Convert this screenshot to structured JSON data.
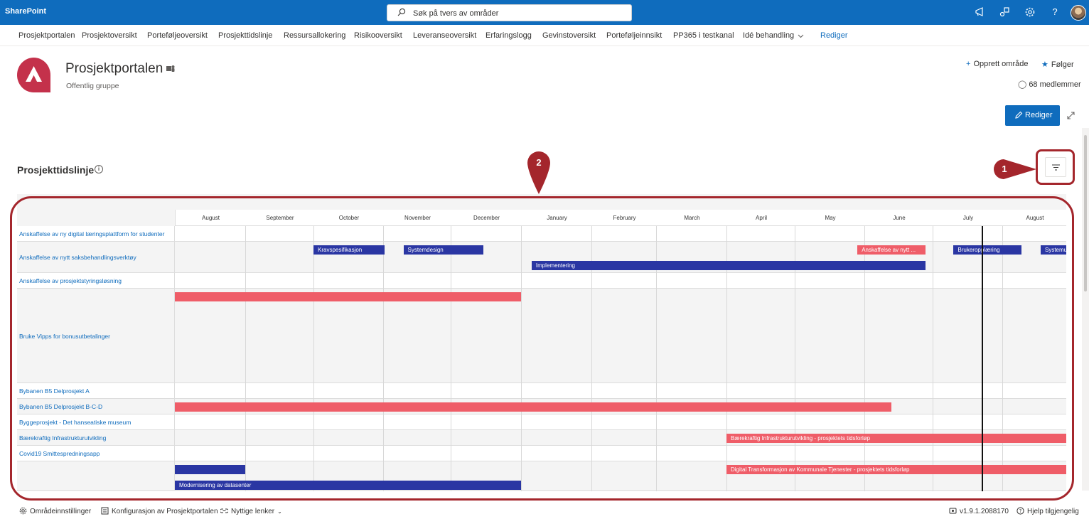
{
  "suitebar": {
    "brand": "SharePoint",
    "search_placeholder": "Søk på tvers av områder",
    "icons": [
      "megaphone-icon",
      "app-icon",
      "gear-icon",
      "help-icon"
    ]
  },
  "nav": {
    "items": [
      "Prosjektportalen",
      "Prosjektoversikt",
      "Porteføljeoversikt",
      "Prosjekttidslinje",
      "Ressursallokering",
      "Risikooversikt",
      "Leveranseoversikt",
      "Erfaringslogg",
      "Gevinstoversikt",
      "Porteføljeinnsikt",
      "PP365 i testkanal",
      "Idé behandling"
    ],
    "edit_label": "Rediger"
  },
  "site": {
    "title": "Prosjektportalen",
    "subtitle": "Offentlig gruppe",
    "create_area": "Opprett område",
    "following": "Følger",
    "members": "68 medlemmer"
  },
  "page": {
    "edit_button": "Rediger"
  },
  "section": {
    "title": "Prosjekttidslinje"
  },
  "timeline": {
    "months": [
      "August",
      "September",
      "October",
      "November",
      "December",
      "January",
      "February",
      "March",
      "April",
      "May",
      "June",
      "July",
      "August"
    ],
    "rows": [
      {
        "label": "Anskaffelse av ny digital læringsplattform for studenter"
      },
      {
        "label": "Anskaffelse av nytt saksbehandlingsverktøy"
      },
      {
        "label": "Anskaffelse av prosjektstyringsløsning"
      },
      {
        "label": "Bruke Vipps for bonusutbetalinger"
      },
      {
        "label": "Bybanen B5 Delprosjekt A"
      },
      {
        "label": "Bybanen B5 Delprosjekt B-C-D"
      },
      {
        "label": "Byggeprosjekt - Det hanseatiske museum"
      },
      {
        "label": "Bærekraftig Infrastrukturutvikling"
      },
      {
        "label": "Covid19 Smittespredningsapp"
      },
      {
        "label": ""
      }
    ],
    "bars": [
      {
        "row": 1,
        "lane": 0,
        "start": 2.0,
        "end": 3.02,
        "color": "blue",
        "label": "Kravspesifikasjon"
      },
      {
        "row": 1,
        "lane": 0,
        "start": 3.3,
        "end": 4.46,
        "color": "blue",
        "label": "Systemdesign"
      },
      {
        "row": 1,
        "lane": 0,
        "start": 9.9,
        "end": 10.9,
        "color": "red",
        "label": "Anskaffelse av nytt ..."
      },
      {
        "row": 1,
        "lane": 0,
        "start": 11.3,
        "end": 12.3,
        "color": "blue",
        "label": "Brukeropplæring"
      },
      {
        "row": 1,
        "lane": 0,
        "start": 12.6,
        "end": 13.2,
        "color": "blue",
        "label": "Systemutvikling"
      },
      {
        "row": 1,
        "lane": 1,
        "start": 5.15,
        "end": 10.9,
        "color": "blue",
        "label": "Implementering"
      },
      {
        "row": 3,
        "lane": 0,
        "start": 0.0,
        "end": 5.0,
        "color": "red",
        "label": ""
      },
      {
        "row": 5,
        "lane": 0,
        "start": 0.0,
        "end": 10.4,
        "color": "red",
        "label": ""
      },
      {
        "row": 7,
        "lane": 0,
        "start": 8.0,
        "end": 13.2,
        "color": "red",
        "label": "Bærekraftig Infrastrukturutvikling - prosjektets tidsforløp"
      },
      {
        "row": 9,
        "lane": 0,
        "start": 0.0,
        "end": 1.0,
        "color": "blue",
        "label": ""
      },
      {
        "row": 9,
        "lane": 0,
        "start": 8.0,
        "end": 13.2,
        "color": "red",
        "label": "Digital Transformasjon av Kommunale Tjenester - prosjektets tidsforløp"
      },
      {
        "row": 9,
        "lane": 1,
        "start": 0.0,
        "end": 5.0,
        "color": "blue",
        "label": "Modernisering av datasenter"
      }
    ],
    "today": 11.7
  },
  "annotations": {
    "marker_1": "1",
    "marker_2": "2"
  },
  "footer": {
    "settings": "Områdeinnstillinger",
    "config": "Konfigurasjon av Prosjektportalen",
    "links": "Nyttige lenker",
    "version": "v1.9.1.2088170",
    "help": "Hjelp tilgjengelig"
  },
  "colors": {
    "suitebar": "#0f6cbd",
    "accent": "#0f6cbd",
    "bar_blue": "#2a36a3",
    "bar_red": "#ef5d68",
    "annotation": "#a4262c"
  }
}
